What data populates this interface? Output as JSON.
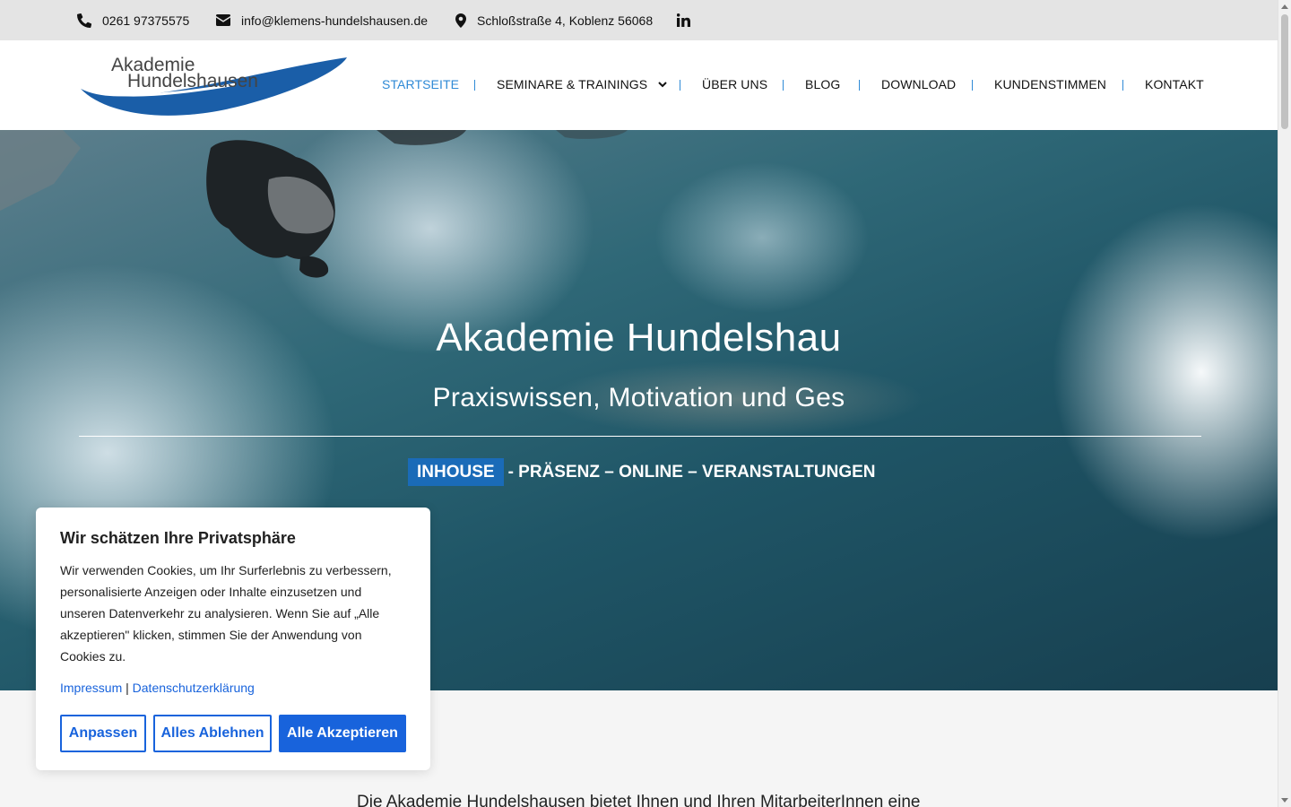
{
  "topbar": {
    "phone": "0261 97375575",
    "email": "info@klemens-hundelshausen.de",
    "address": "Schloßstraße 4, Koblenz 56068",
    "icons": [
      "phone-icon",
      "envelope-icon",
      "map-pin-icon",
      "linkedin-icon"
    ]
  },
  "logo": {
    "line1": "Akademie",
    "line2": "Hundelshausen"
  },
  "nav": {
    "items": [
      "STARTSEITE",
      "SEMINARE & TRAININGS",
      "ÜBER UNS",
      "BLOG",
      "DOWNLOAD",
      "KUNDENSTIMMEN",
      "KONTAKT"
    ],
    "active": "STARTSEITE"
  },
  "hero": {
    "title": "Akademie Hundelshau",
    "subtitle": "Praxiswissen, Motivation und Ges",
    "badge": "INHOUSE",
    "tagline": "- PRÄSENZ – ONLINE – VERANSTALTUNGEN"
  },
  "intro": {
    "text": "Die Akademie Hundelshausen bietet Ihnen und Ihren MitarbeiterInnen eine"
  },
  "cookie": {
    "title": "Wir schätzen Ihre Privatsphäre",
    "text": "Wir verwenden Cookies, um Ihr Surferlebnis zu verbessern, personalisierte Anzeigen oder Inhalte einzusetzen und unseren Datenverkehr zu analysieren. Wenn Sie auf „Alle akzeptieren\" klicken, stimmen Sie der Anwendung von Cookies zu.",
    "link_impressum": "Impressum",
    "link_separator": "|",
    "link_privacy": "Datenschutzerklärung",
    "btn_customize": "Anpassen",
    "btn_reject": "Alles Ablehnen",
    "btn_accept": "Alle Akzeptieren"
  },
  "colors": {
    "accent": "#2f8ad6",
    "brand_blue": "#1a5ea8",
    "cookie_blue": "#1863dc",
    "badge_blue": "#1a6bb8",
    "topbar_bg": "#e4e4e4"
  }
}
